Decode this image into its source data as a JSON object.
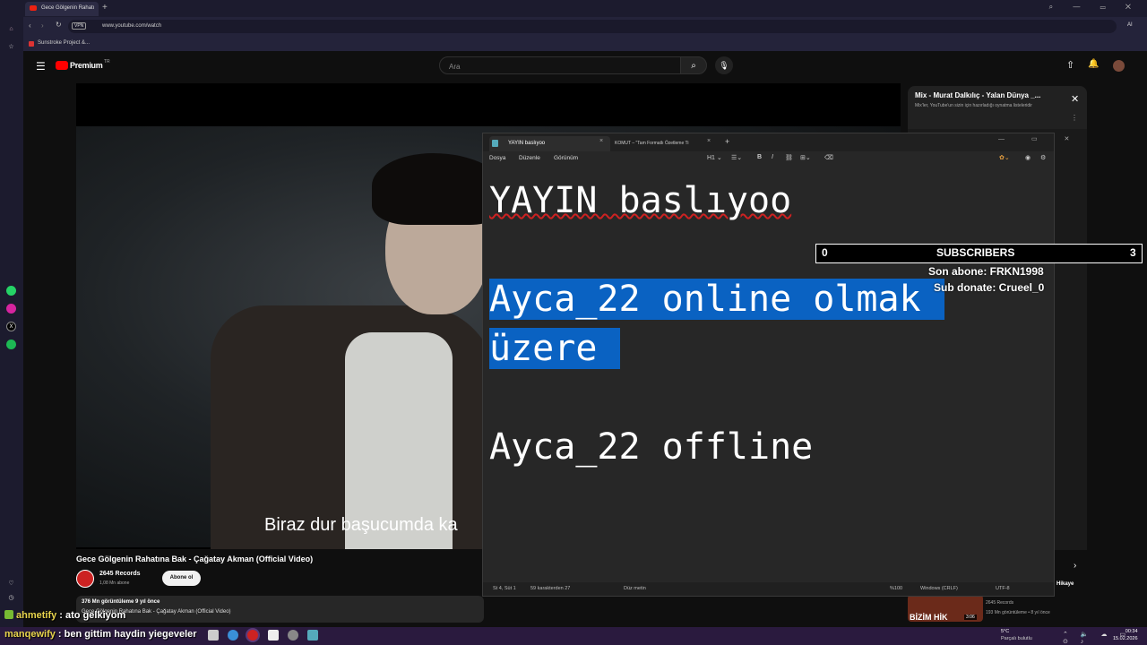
{
  "browser": {
    "tab_title": "Gece Gölgenin Rahatı",
    "url": "www.youtube.com/watch",
    "vpn": "VPN",
    "bookmark": "Sunstroke Project &...",
    "ai_label": "AI"
  },
  "youtube": {
    "logo": "Premium",
    "logo_region": "TR",
    "search_placeholder": "Ara",
    "caption": "Biraz dur başucumda ka",
    "video_title": "Gece Gölgenin Rahatına Bak - Çağatay Akman (Official Video)",
    "channel_name": "2645 Records",
    "channel_subs": "1,08 Mn abone",
    "subscribe_label": "Abone ol",
    "desc_stats": "376 Mn görüntüleme  9 yıl önce",
    "desc_line": "Gece Gölgenin Rahatına Bak - Çağatay Akman (Official  Video)",
    "mix_title": "Mix - Murat Dalkılıç - Yalan Dünya _...",
    "mix_subtitle": "Mix'ler, YouTube'un sizin için hazırladığı oynatma listeleridir",
    "rec_stamp": "BİZİM HİK",
    "rec_duration": "3:06",
    "rec_channel": "2645 Records",
    "rec_stats": "193 Mn görüntüleme • 8 yıl önce",
    "rec_hikaye": "Hikaye"
  },
  "notepad": {
    "tab_active": "YAYIN baslıyoo",
    "tab_second": "KOMUT – \"Tam Formatlı Özetleme Ti",
    "menu": [
      "Dosya",
      "Düzenle",
      "Görünüm"
    ],
    "heading_select": "H1",
    "lines": {
      "line1": "YAYIN baslıyoo",
      "line2": "Ayca_22 online olmak",
      "line3": "üzere",
      "line4": "Ayca_22 offline"
    },
    "status": {
      "position": "St 4, Süt 1",
      "chars": "59 karakterden 27",
      "format": "Düz metin",
      "zoom": "%100",
      "line_ending": "Windows (CRLF)",
      "encoding": "UTF-8"
    }
  },
  "overlay": {
    "sub_left": "0",
    "sub_label": "SUBSCRIBERS",
    "sub_right": "3",
    "last_sub": "Son abone: FRKN1998",
    "sub_donate": "Sub donate: Crueel_0"
  },
  "chat": [
    {
      "user": "ahmetify",
      "message": " : ato gelkiyom"
    },
    {
      "user": "manqewify",
      "message": " : ben gittim haydin yiegeveler"
    }
  ],
  "taskbar": {
    "weather_temp": "5°C",
    "weather_desc": "Parçalı bulutlu",
    "time": "00:34",
    "date": "15.02.2026"
  },
  "colors": {
    "selection": "#0a62c2",
    "youtube_red": "#ff0000",
    "chat_user": "#e8d44d"
  }
}
